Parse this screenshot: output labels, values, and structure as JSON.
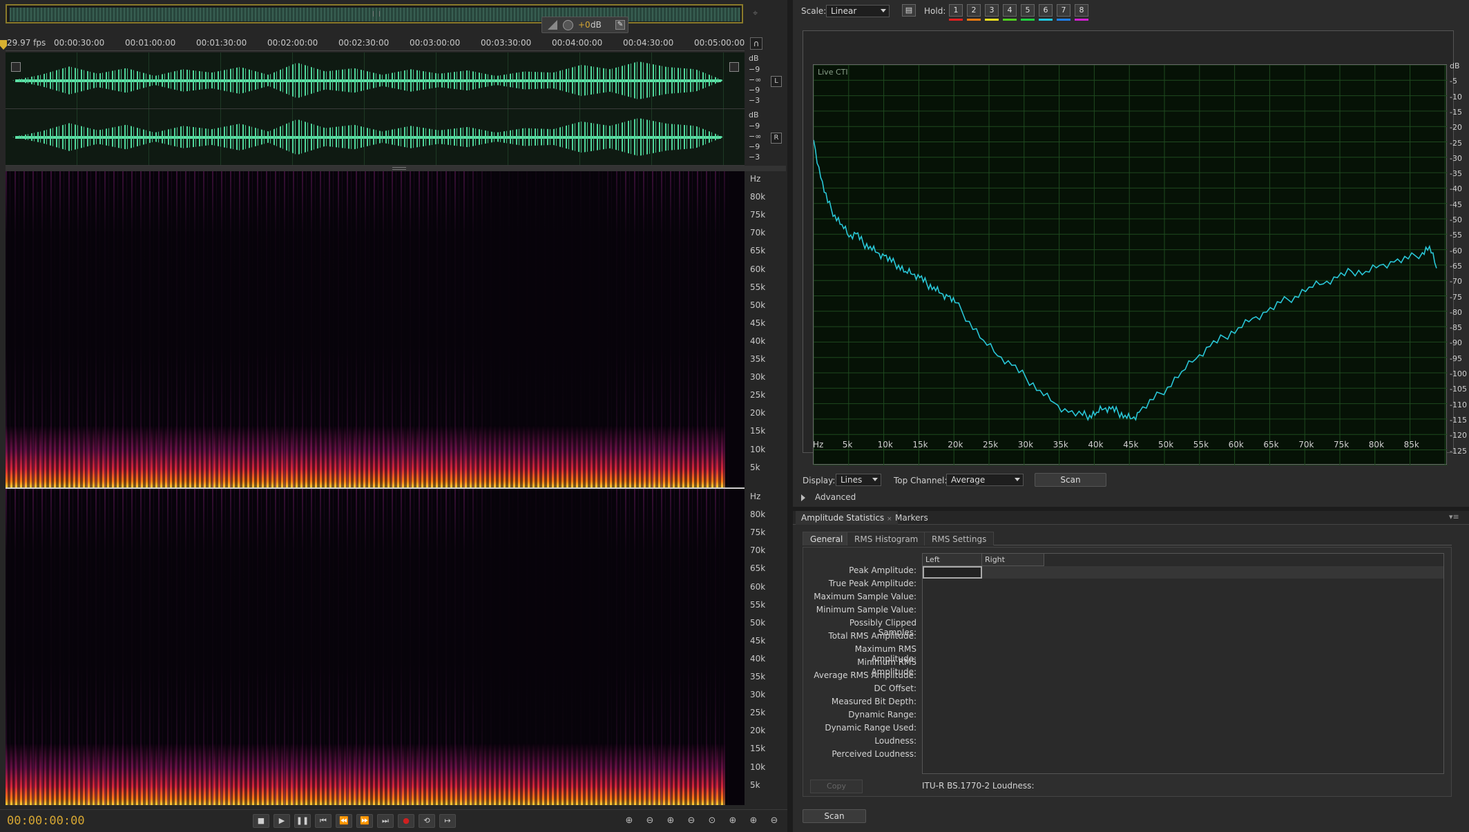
{
  "editor": {
    "hud": {
      "value": "+0",
      "unit": "dB"
    },
    "fps_label": "29.97 fps",
    "ruler_ticks": [
      "00:00:30:00",
      "00:01:00:00",
      "00:01:30:00",
      "00:02:00:00",
      "00:02:30:00",
      "00:03:00:00",
      "00:03:30:00",
      "00:04:00:00",
      "00:04:30:00",
      "00:05:00:00"
    ],
    "db_labels_top": [
      "dB",
      "−9",
      "−∞",
      "−9",
      "−3"
    ],
    "db_labels_bottom": [
      "dB",
      "−9",
      "−∞",
      "−9",
      "−3"
    ],
    "channel_left": "L",
    "channel_right": "R",
    "hz_labels": [
      "Hz",
      "80k",
      "75k",
      "70k",
      "65k",
      "60k",
      "55k",
      "50k",
      "45k",
      "40k",
      "35k",
      "30k",
      "25k",
      "20k",
      "15k",
      "10k",
      "5k"
    ],
    "timecode": "00:00:00:00",
    "colors": {
      "waveform": "#5fe0a6",
      "timecode": "#d5a633"
    }
  },
  "analysis": {
    "scale_label": "Scale:",
    "scale_value": "Linear",
    "hold_label": "Hold:",
    "hold_buttons": [
      "1",
      "2",
      "3",
      "4",
      "5",
      "6",
      "7",
      "8"
    ],
    "hold_colors": [
      "#e02020",
      "#f07a10",
      "#f0e020",
      "#50d020",
      "#20d040",
      "#20c8e0",
      "#2080f0",
      "#d020d0"
    ],
    "live_cti": "Live CTI",
    "display_label": "Display:",
    "display_value": "Lines",
    "top_channel_label": "Top Channel:",
    "top_channel_value": "Average",
    "scan_label": "Scan",
    "advanced_label": "Advanced"
  },
  "chart_data": {
    "type": "line",
    "xlabel": "Hz",
    "ylabel": "dB",
    "x_tick_labels": [
      "Hz",
      "5k",
      "10k",
      "15k",
      "20k",
      "25k",
      "30k",
      "35k",
      "40k",
      "45k",
      "50k",
      "55k",
      "60k",
      "65k",
      "70k",
      "75k",
      "80k",
      "85k"
    ],
    "y_tick_labels": [
      "dB",
      "-5",
      "-10",
      "-15",
      "-20",
      "-25",
      "-30",
      "-35",
      "-40",
      "-45",
      "-50",
      "-55",
      "-60",
      "-65",
      "-70",
      "-75",
      "-80",
      "-85",
      "-90",
      "-95",
      "-100",
      "-105",
      "-110",
      "-115",
      "-120",
      "-125"
    ],
    "xlim": [
      0,
      88000
    ],
    "ylim": [
      0,
      -128
    ],
    "grid": true,
    "series": [
      {
        "color": "#29c6d6",
        "x": [
          0,
          1000,
          2000,
          3000,
          4000,
          5000,
          6000,
          7000,
          8000,
          9000,
          10000,
          11000,
          12000,
          13000,
          14000,
          15000,
          16000,
          17000,
          18000,
          19000,
          20000,
          22000,
          24000,
          26000,
          28000,
          30000,
          32000,
          34000,
          36000,
          38000,
          39000,
          40000,
          41000,
          42000,
          43000,
          44000,
          45000,
          46000,
          48000,
          50000,
          52000,
          54000,
          56000,
          58000,
          60000,
          62000,
          64000,
          66000,
          68000,
          70000,
          72000,
          74000,
          76000,
          78000,
          80000,
          82000,
          84000,
          86000,
          87000,
          88000
        ],
        "y": [
          -24,
          -36,
          -44,
          -48,
          -51,
          -55,
          -54,
          -57,
          -58,
          -60,
          -61,
          -63,
          -64,
          -66,
          -67,
          -68,
          -70,
          -71,
          -73,
          -74,
          -76,
          -82,
          -88,
          -93,
          -96,
          -100,
          -104,
          -108,
          -111,
          -112,
          -112,
          -111,
          -110,
          -110,
          -111,
          -112,
          -113,
          -111,
          -107,
          -103,
          -98,
          -94,
          -90,
          -87,
          -84,
          -81,
          -79,
          -76,
          -74,
          -71,
          -70,
          -68,
          -66,
          -66,
          -64,
          -63,
          -62,
          -60,
          -58,
          -65
        ]
      }
    ]
  },
  "stats": {
    "tabs": [
      "Amplitude Statistics",
      "Markers"
    ],
    "subtabs": [
      "General",
      "RMS Histogram",
      "RMS Settings"
    ],
    "columns": [
      "Left",
      "Right"
    ],
    "rows": [
      "Peak Amplitude:",
      "True Peak Amplitude:",
      "Maximum Sample Value:",
      "Minimum Sample Value:",
      "Possibly Clipped Samples:",
      "Total RMS Amplitude:",
      "Maximum RMS Amplitude:",
      "Minimum RMS Amplitude:",
      "Average RMS Amplitude:",
      "DC Offset:",
      "Measured Bit Depth:",
      "Dynamic Range:",
      "Dynamic Range Used:",
      "Loudness:",
      "Perceived Loudness:"
    ],
    "copy_label": "Copy",
    "itu_label": "ITU-R BS.1770-2 Loudness:",
    "scan_label": "Scan"
  }
}
